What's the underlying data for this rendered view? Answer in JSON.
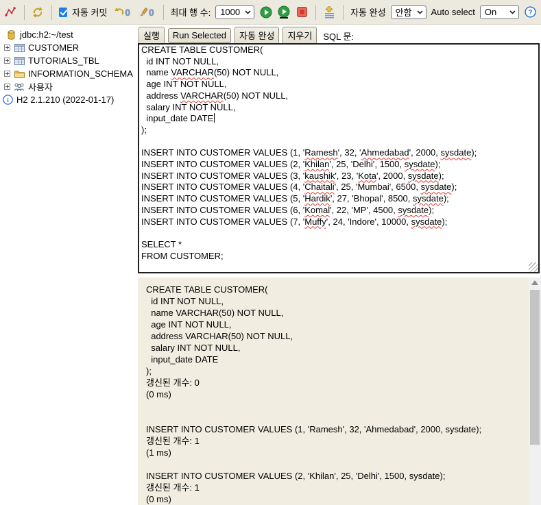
{
  "toolbar": {
    "auto_commit_label": "자동 커밋",
    "undo_count": "0",
    "edit_count": "0",
    "max_rows_label": "최대 행 수:",
    "max_rows_value": "1000",
    "autocomplete_label": "자동 완성",
    "autocomplete_value": "안함",
    "auto_select_label": "Auto select",
    "auto_select_value": "On",
    "icons": [
      "disconnect-icon",
      "refresh-icon",
      "auto-commit-checkbox",
      "undo-icon",
      "edit-count-icon",
      "run-icon",
      "run-selected-icon",
      "stop-icon",
      "autocomplete-icon",
      "help-icon"
    ]
  },
  "sidebar": {
    "connection": "jdbc:h2:~/test",
    "items": [
      {
        "label": "CUSTOMER",
        "icon": "table-icon"
      },
      {
        "label": "TUTORIALS_TBL",
        "icon": "table-icon"
      },
      {
        "label": "INFORMATION_SCHEMA",
        "icon": "folder-icon"
      },
      {
        "label": "사용자",
        "icon": "users-icon"
      }
    ],
    "version": "H2 2.1.210 (2022-01-17)"
  },
  "editor": {
    "buttons": {
      "run": "실행",
      "run_selected": "Run Selected",
      "autocomplete": "자동 완성",
      "clear": "지우기"
    },
    "sql_label": "SQL 문:",
    "cursor_line": 6,
    "misspelled": [
      "VARCHAR",
      "Ramesh",
      "Ahmedabad",
      "sysdate",
      "Khilan",
      "kaushik",
      "Kota",
      "Chaitali",
      "Hardik",
      "Komal",
      "Muffy"
    ],
    "sql_lines": [
      "CREATE TABLE CUSTOMER(",
      "  id INT NOT NULL,",
      "  name VARCHAR(50) NOT NULL,",
      "  age INT NOT NULL,",
      "  address VARCHAR(50) NOT NULL,",
      "  salary INT NOT NULL,",
      "  input_date DATE",
      ");",
      "",
      "INSERT INTO CUSTOMER VALUES (1, 'Ramesh', 32, 'Ahmedabad', 2000, sysdate);",
      "INSERT INTO CUSTOMER VALUES (2, 'Khilan', 25, 'Delhi', 1500, sysdate);",
      "INSERT INTO CUSTOMER VALUES (3, 'kaushik', 23, 'Kota', 2000, sysdate);",
      "INSERT INTO CUSTOMER VALUES (4, 'Chaitali', 25, 'Mumbai', 6500, sysdate);",
      "INSERT INTO CUSTOMER VALUES (5, 'Hardik', 27, 'Bhopal', 8500, sysdate);",
      "INSERT INTO CUSTOMER VALUES (6, 'Komal', 22, 'MP', 4500, sysdate);",
      "INSERT INTO CUSTOMER VALUES (7, 'Muffy', 24, 'Indore', 10000, sysdate);",
      "",
      "SELECT *",
      "FROM CUSTOMER;"
    ]
  },
  "results": {
    "lines": [
      "CREATE TABLE CUSTOMER(",
      "  id INT NOT NULL,",
      "  name VARCHAR(50) NOT NULL,",
      "  age INT NOT NULL,",
      "  address VARCHAR(50) NOT NULL,",
      "  salary INT NOT NULL,",
      "  input_date DATE",
      ");",
      "갱신된 개수: 0",
      "(0 ms)",
      "",
      "",
      "INSERT INTO CUSTOMER VALUES (1, 'Ramesh', 32, 'Ahmedabad', 2000, sysdate);",
      "갱신된 개수: 1",
      "(1 ms)",
      "",
      "INSERT INTO CUSTOMER VALUES (2, 'Khilan', 25, 'Delhi', 1500, sysdate);",
      "갱신된 개수: 1",
      "(0 ms)"
    ]
  },
  "colors": {
    "toolbar_bg": "#eceadf",
    "results_bg": "#f1eee1",
    "accent_blue": "#1d7fe8",
    "run_green": "#2f9e44",
    "stop_red": "#e24a3c",
    "squiggle_red": "#e0382e",
    "gold": "#d29e00"
  }
}
